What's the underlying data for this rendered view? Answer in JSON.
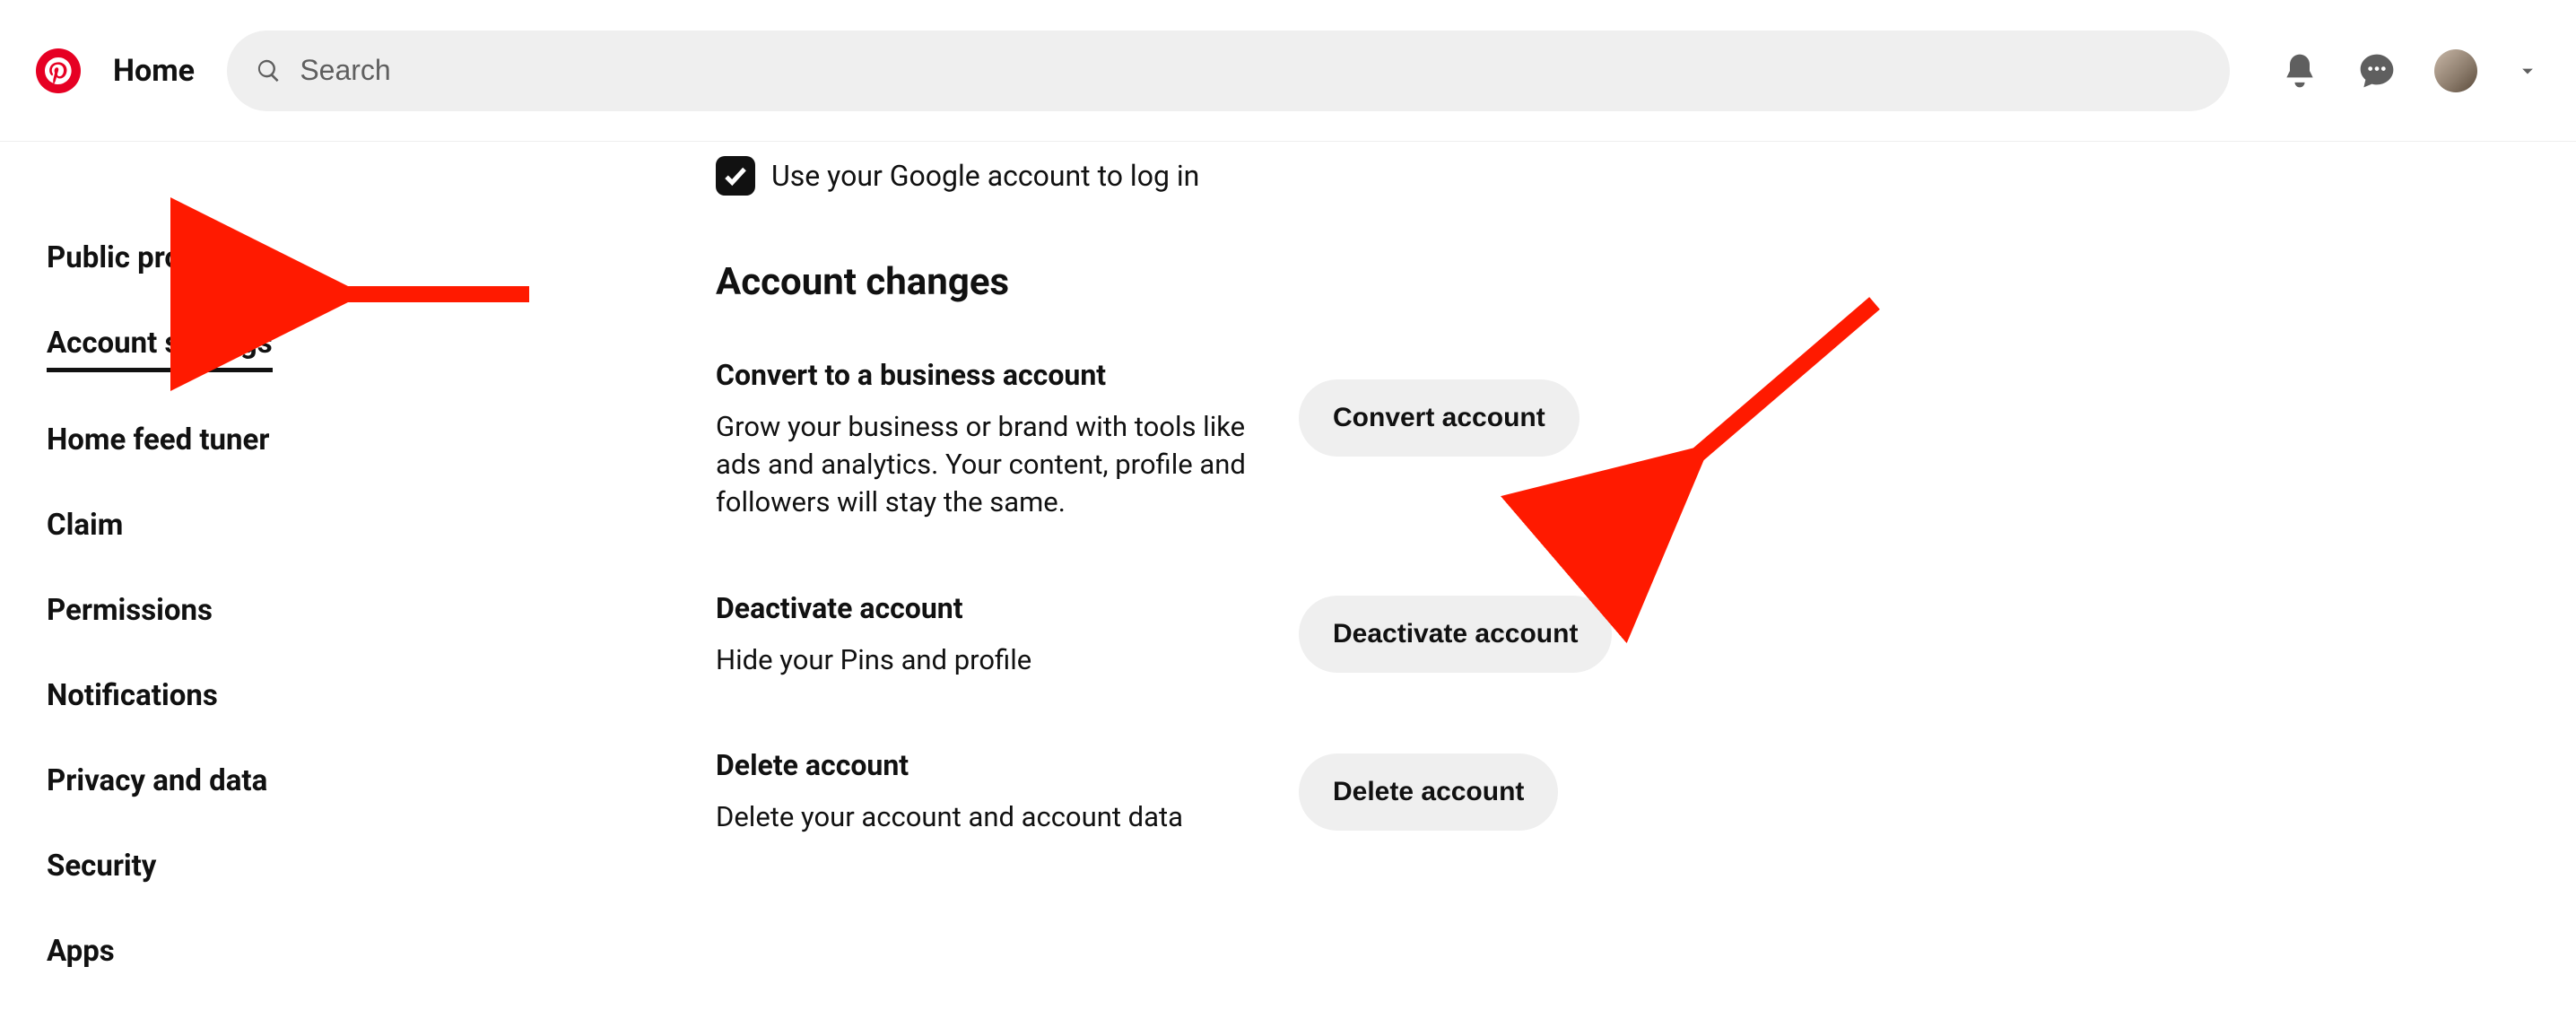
{
  "header": {
    "home": "Home",
    "search_placeholder": "Search"
  },
  "sidebar": {
    "items": [
      {
        "label": "Public profile",
        "name": "sidebar-item-public-profile",
        "active": false
      },
      {
        "label": "Account settings",
        "name": "sidebar-item-account-settings",
        "active": true
      },
      {
        "label": "Home feed tuner",
        "name": "sidebar-item-home-feed-tuner",
        "active": false
      },
      {
        "label": "Claim",
        "name": "sidebar-item-claim",
        "active": false
      },
      {
        "label": "Permissions",
        "name": "sidebar-item-permissions",
        "active": false
      },
      {
        "label": "Notifications",
        "name": "sidebar-item-notifications",
        "active": false
      },
      {
        "label": "Privacy and data",
        "name": "sidebar-item-privacy-and-data",
        "active": false
      },
      {
        "label": "Security",
        "name": "sidebar-item-security",
        "active": false
      },
      {
        "label": "Apps",
        "name": "sidebar-item-apps",
        "active": false
      }
    ]
  },
  "main": {
    "google_login_label": "Use your Google account to log in",
    "section_title": "Account changes",
    "settings": [
      {
        "label": "Convert to a business account",
        "desc": "Grow your business or brand with tools like ads and analytics. Your content, profile and followers will stay the same.",
        "button": "Convert account",
        "btn_name": "convert-account-button"
      },
      {
        "label": "Deactivate account",
        "desc": "Hide your Pins and profile",
        "button": "Deactivate account",
        "btn_name": "deactivate-account-button"
      },
      {
        "label": "Delete account",
        "desc": "Delete your account and account data",
        "button": "Delete account",
        "btn_name": "delete-account-button"
      }
    ]
  },
  "annotations": {
    "arrow1_target": "sidebar-item-account-settings",
    "arrow2_target": "convert-account-button"
  }
}
